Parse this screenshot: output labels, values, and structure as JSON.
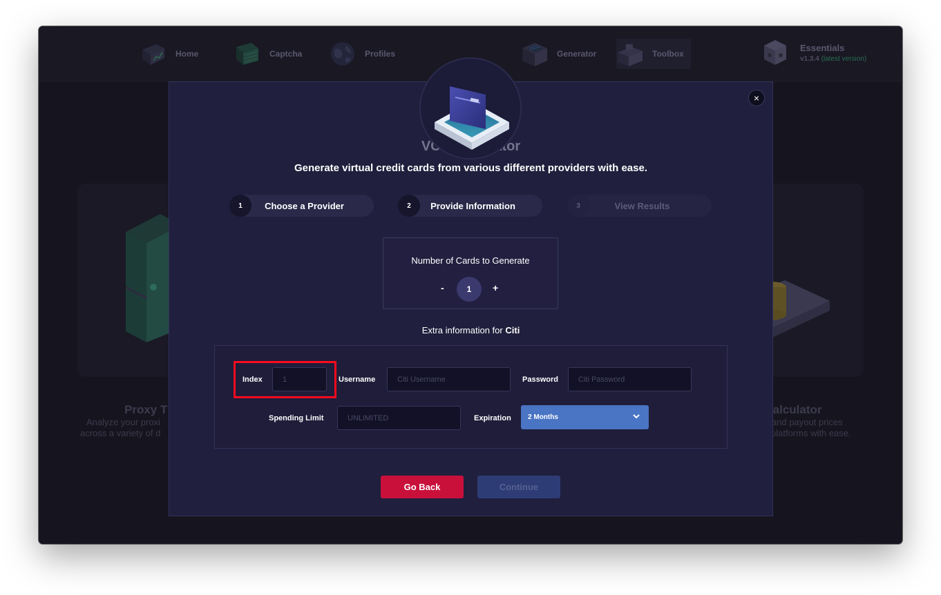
{
  "nav": {
    "items": [
      {
        "label": "Home"
      },
      {
        "label": "Captcha"
      },
      {
        "label": "Profiles"
      },
      {
        "label": "Generator"
      },
      {
        "label": "Toolbox"
      }
    ],
    "essentials": {
      "title": "Essentials",
      "version": "v1.3.4",
      "latest": "(latest version)"
    }
  },
  "background": {
    "left_card": {
      "title": "Proxy T",
      "line1": "Analyze your proxi",
      "line2": "across a variety of d"
    },
    "right_card": {
      "title": "t Calculator",
      "line1": "ale and payout prices",
      "line2": "platforms with ease."
    }
  },
  "modal": {
    "close_label": "×",
    "title": "VCC Generator",
    "subtitle": "Generate virtual credit cards from various different providers with ease.",
    "steps": [
      {
        "num": "1",
        "label": "Choose a Provider",
        "state": "done"
      },
      {
        "num": "2",
        "label": "Provide Information",
        "state": "active"
      },
      {
        "num": "3",
        "label": "View Results",
        "state": "disabled"
      }
    ],
    "count": {
      "label": "Number of Cards to Generate",
      "minus": "-",
      "plus": "+",
      "value": "1"
    },
    "extra": {
      "prefix": "Extra information for",
      "provider": "Citi"
    },
    "fields": {
      "index": {
        "label": "Index",
        "placeholder": "1"
      },
      "username": {
        "label": "Username",
        "placeholder": "Citi Username"
      },
      "password": {
        "label": "Password",
        "placeholder": "Citi Password"
      },
      "spending": {
        "label": "Spending Limit",
        "placeholder": "UNLIMITED"
      },
      "expiration": {
        "label": "Expiration",
        "value": "2 Months"
      }
    },
    "buttons": {
      "back": "Go Back",
      "continue": "Continue"
    }
  },
  "colors": {
    "accent": "#4a74c4",
    "danger": "#c8103b",
    "highlight": "#ff0a1e",
    "modal_bg": "#201f3d"
  }
}
